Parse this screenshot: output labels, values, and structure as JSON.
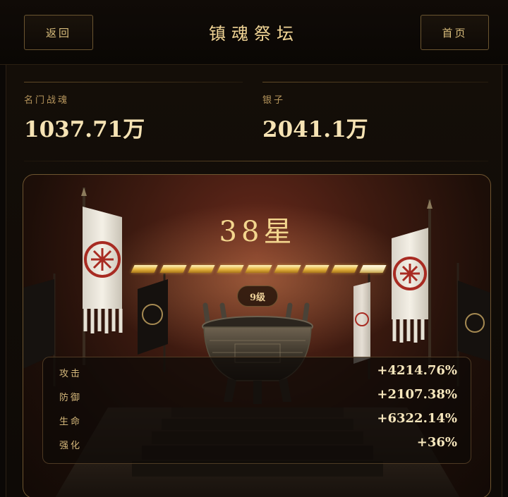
{
  "header": {
    "back_label": "返回",
    "title": "镇魂祭坛",
    "home_label": "首页"
  },
  "stats": [
    {
      "label": "名门战魂",
      "value": "1037.71万"
    },
    {
      "label": "银子",
      "value": "2041.1万"
    }
  ],
  "altar": {
    "stars_label": "38星",
    "star_bars_total": 9,
    "star_bars_filled": 9,
    "level_badge": "9级"
  },
  "attributes": [
    {
      "name": "攻击",
      "value": "+4214.76%"
    },
    {
      "name": "防御",
      "value": "+2107.38%"
    },
    {
      "name": "生命",
      "value": "+6322.14%"
    },
    {
      "name": "强化",
      "value": "+36%"
    }
  ],
  "colors": {
    "accent_gold": "#f3d68e",
    "panel_border": "#6e5530",
    "background": "#0b0806"
  }
}
